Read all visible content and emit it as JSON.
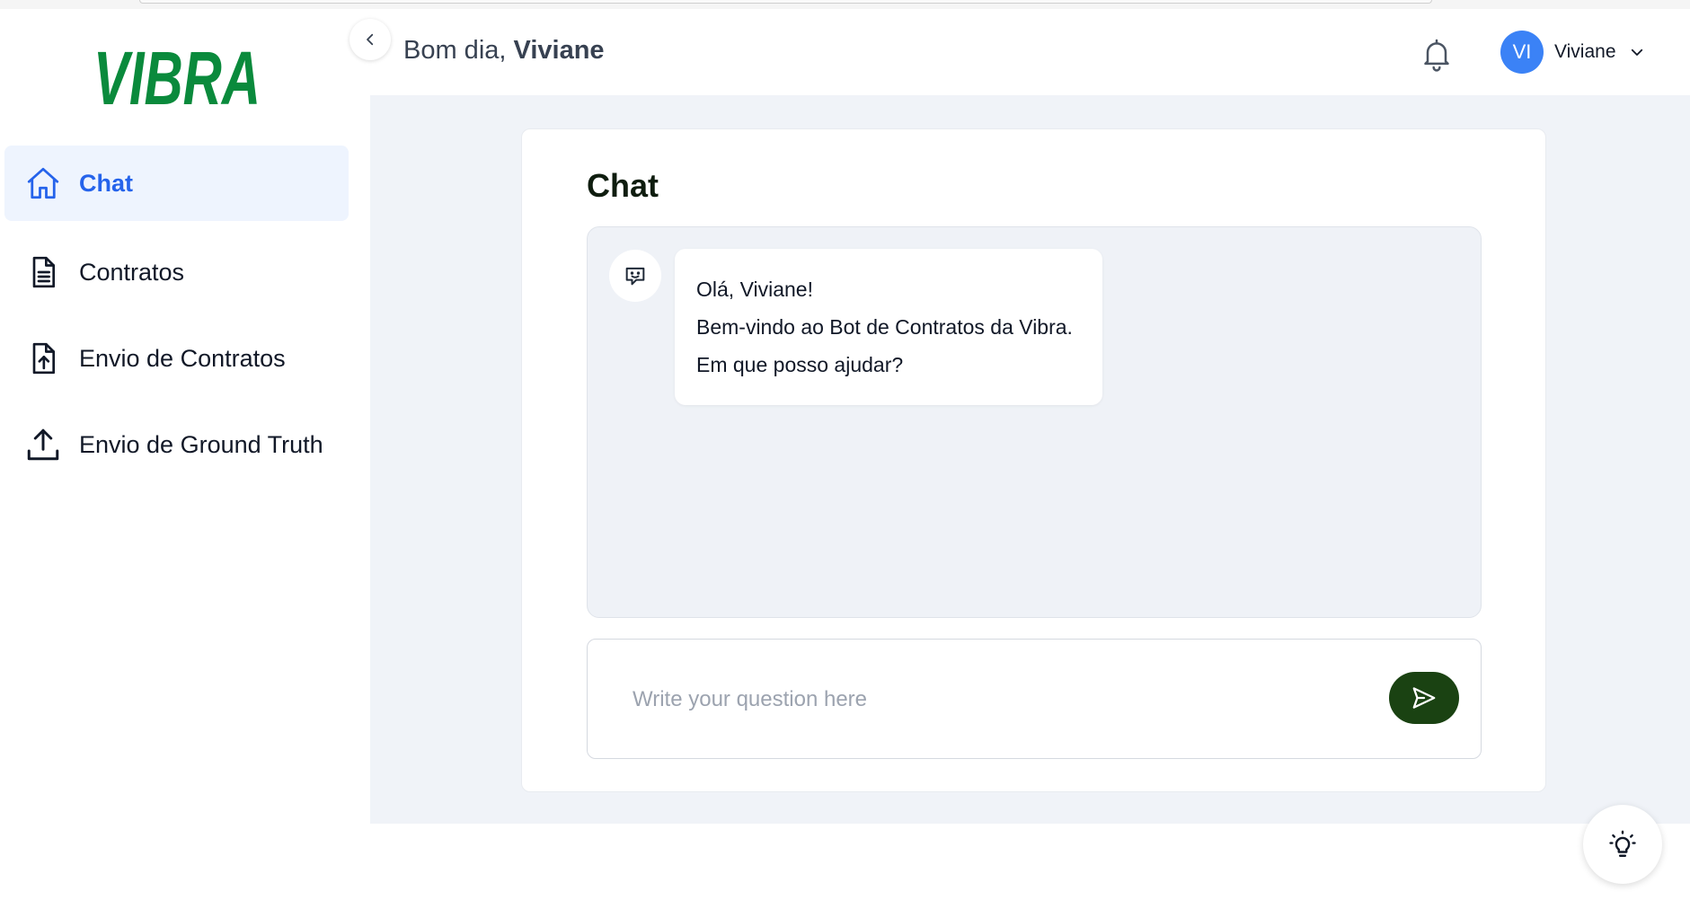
{
  "brand": {
    "logo_text": "VIBRA",
    "logo_color": "#0a8a3c"
  },
  "sidebar": {
    "items": [
      {
        "label": "Chat",
        "icon": "home-icon",
        "active": true
      },
      {
        "label": "Contratos",
        "icon": "document-icon",
        "active": false
      },
      {
        "label": "Envio de Contratos",
        "icon": "file-upload-icon",
        "active": false
      },
      {
        "label": "Envio de Ground Truth",
        "icon": "upload-icon",
        "active": false
      }
    ]
  },
  "header": {
    "greeting_prefix": "Bom dia,",
    "greeting_name": "Viviane",
    "notification_icon": "bell-icon",
    "user": {
      "initials": "VI",
      "name": "Viviane",
      "avatar_color": "#3b82f6"
    }
  },
  "chat": {
    "title": "Chat",
    "bot_icon": "chat-bot-icon",
    "messages": [
      {
        "sender": "bot",
        "lines": [
          "Olá, Viviane!",
          "Bem-vindo ao Bot de Contratos da Vibra.",
          "Em que posso ajudar?"
        ]
      }
    ],
    "input": {
      "placeholder": "Write your question here",
      "value": ""
    },
    "send_icon": "send-icon",
    "send_color": "#1a4212"
  },
  "floating": {
    "tips_icon": "lightbulb-icon"
  },
  "colors": {
    "accent": "#2563eb",
    "active_bg": "#eef4fe",
    "main_bg": "#f0f3f8"
  }
}
